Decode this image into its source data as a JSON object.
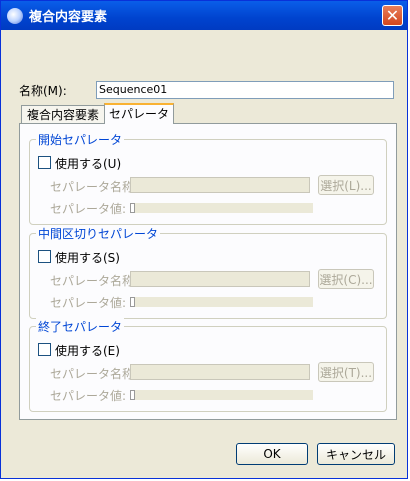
{
  "window": {
    "title": "複合内容要素",
    "close": "✕"
  },
  "name": {
    "label": "名称(M):",
    "value": "Sequence01"
  },
  "tabs": [
    {
      "label": "複合内容要素",
      "active": false
    },
    {
      "label": "セパレータ",
      "active": true
    }
  ],
  "groups": [
    {
      "title": "開始セパレータ",
      "use_label": "使用する(U)",
      "sep_name_label": "セパレータ名称:",
      "select_label": "選択(L)...",
      "sep_value_label": "セパレータ値:"
    },
    {
      "title": "中間区切りセパレータ",
      "use_label": "使用する(S)",
      "sep_name_label": "セパレータ名称:",
      "select_label": "選択(C)...",
      "sep_value_label": "セパレータ値:"
    },
    {
      "title": "終了セパレータ",
      "use_label": "使用する(E)",
      "sep_name_label": "セパレータ名称:",
      "select_label": "選択(T)...",
      "sep_value_label": "セパレータ値:"
    }
  ],
  "buttons": {
    "ok": "OK",
    "cancel": "キャンセル"
  },
  "colors": {
    "accent": "#0046d5",
    "titlebar": "#0a5ee9",
    "tab_highlight": "#f9b233"
  }
}
